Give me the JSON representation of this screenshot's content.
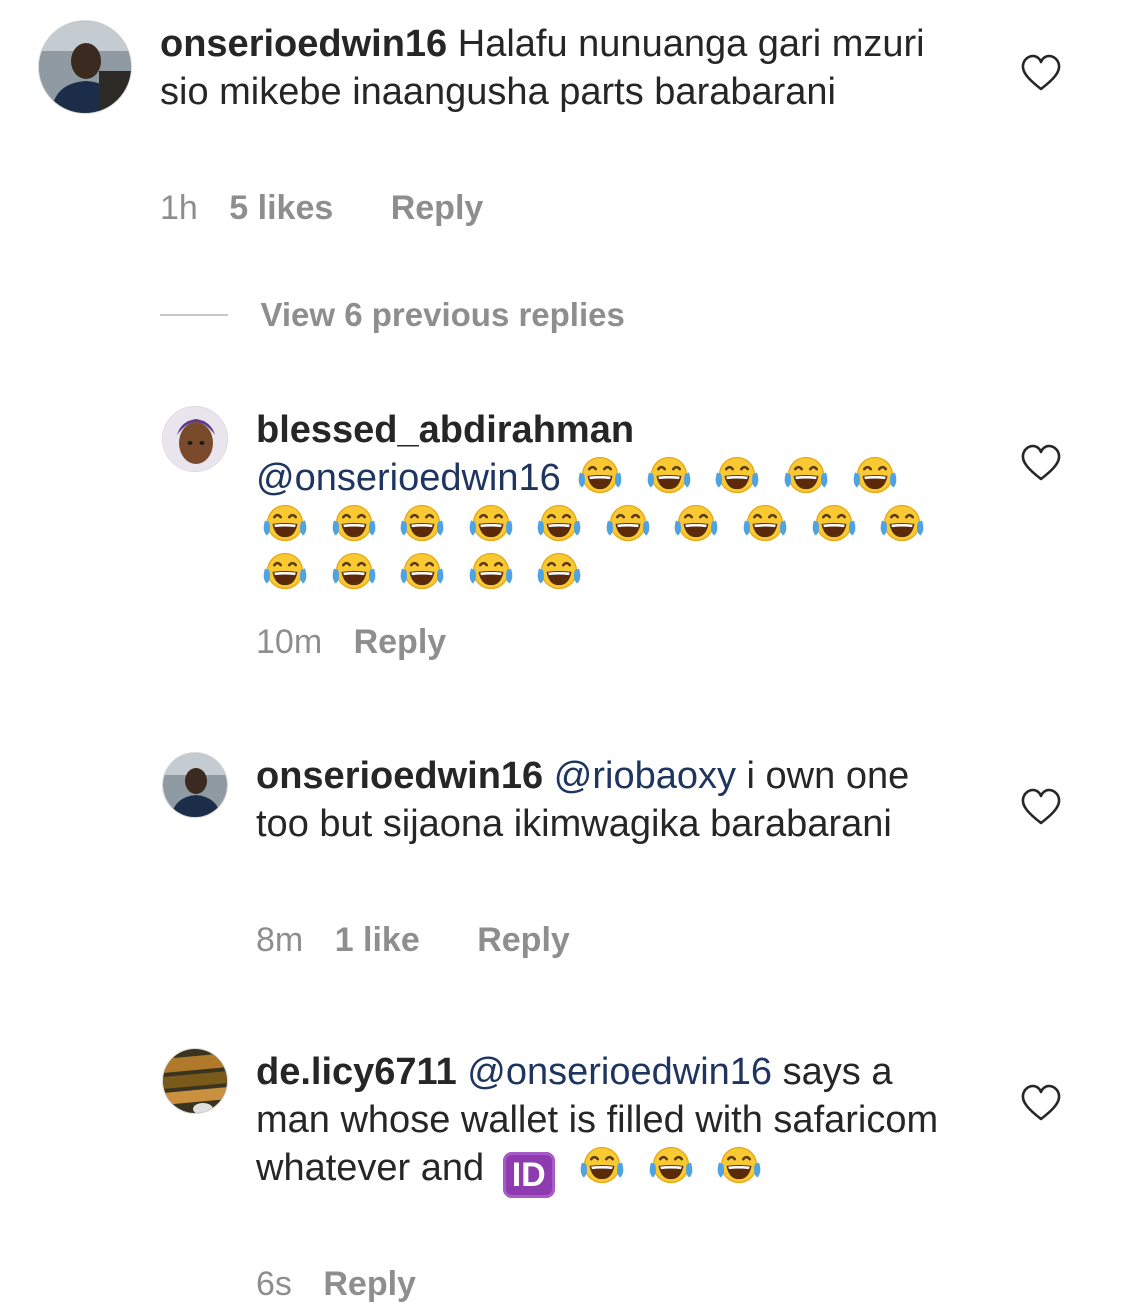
{
  "comments": [
    {
      "username": "onserioedwin16",
      "mention": "",
      "text": "Halafu nunuanga gari mzuri sio mikebe inaangusha parts barabarani",
      "time": "1h",
      "likes": "5 likes",
      "reply_label": "Reply"
    },
    {
      "username": "blessed_abdirahman",
      "mention": "@onserioedwin16",
      "text": "",
      "emoji_count": 20,
      "time": "10m",
      "likes": "",
      "reply_label": "Reply"
    },
    {
      "username": "onserioedwin16",
      "mention": "@riobaoxy",
      "text": "i own one too but sijaona ikimwagika barabarani",
      "time": "8m",
      "likes": "1 like",
      "reply_label": "Reply"
    },
    {
      "username": "de.licy6711",
      "mention": "@onserioedwin16",
      "text": "says a man whose wallet is filled with safaricom whatever and",
      "badge": "ID",
      "emoji_count": 3,
      "time": "6s",
      "likes": "",
      "reply_label": "Reply"
    }
  ],
  "view_replies_label": "View 6 previous replies",
  "icons": {
    "like": "heart-outline-icon",
    "emoji": "face-with-tears-of-joy-emoji"
  },
  "colors": {
    "text": "#262626",
    "meta": "#8e8e8e",
    "mention": "#1e3560",
    "divider": "#c7c7c7"
  }
}
